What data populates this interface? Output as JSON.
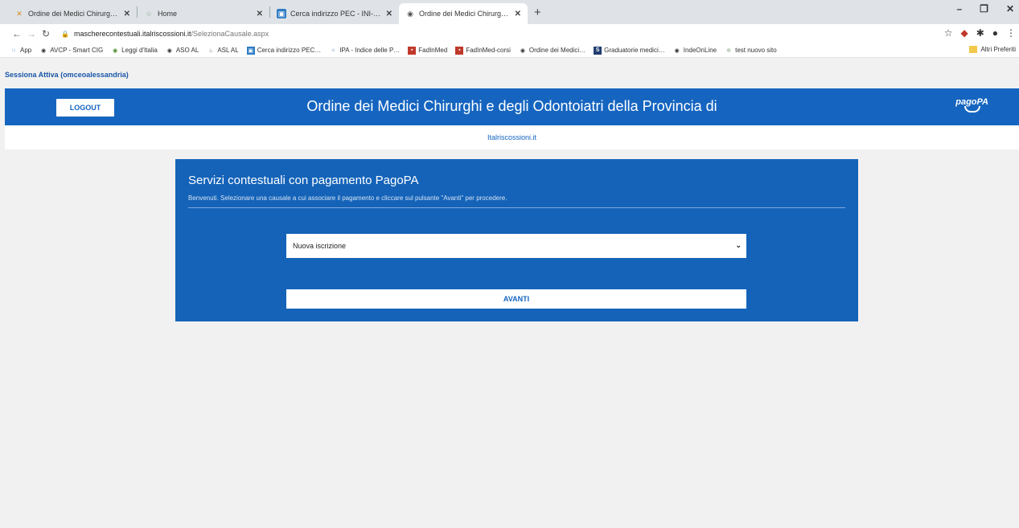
{
  "browser": {
    "tabs": [
      {
        "title": "Ordine dei Medici Chirurghi e d…"
      },
      {
        "title": "Home"
      },
      {
        "title": "Cerca indirizzo PEC - INI-PEC"
      },
      {
        "title": "Ordine dei Medici Chirurghi e d…"
      }
    ],
    "new_tab": "+",
    "url_host": "mascherecontestuali.italriscossioni.it",
    "url_path": "/SelezionaCausale.aspx",
    "bookmarks": [
      {
        "label": "App"
      },
      {
        "label": "AVCP - Smart CIG"
      },
      {
        "label": "Leggi d'Italia"
      },
      {
        "label": "ASO AL"
      },
      {
        "label": "ASL AL"
      },
      {
        "label": "Cerca indirizzo PEC…"
      },
      {
        "label": "IPA - Indice delle P…"
      },
      {
        "label": "FadInMed"
      },
      {
        "label": "FadInMed-corsi"
      },
      {
        "label": "Ordine dei Medici…"
      },
      {
        "label": "Graduatorie medici…"
      },
      {
        "label": "IndeOnLine"
      },
      {
        "label": "test nuovo sito"
      }
    ],
    "other_bookmarks": "Altri Preferiti"
  },
  "page": {
    "session": "Sessiona Attiva (omceoalessandria)",
    "logout": "LOGOUT",
    "org_title": "Ordine dei Medici Chirurghi e degli Odontoiatri della Provincia di",
    "logo_text": "pagoPA",
    "subheader": "Italriscossioni.it",
    "panel_title": "Servizi contestuali con pagamento PagoPA",
    "panel_subtitle": "Benvenuti. Selezionare una causale a cui associare il pagamento e cliccare sul pulsante \"Avanti\" per procedere.",
    "select_value": "Nuova iscrizione",
    "avanti": "AVANTI"
  },
  "colors": {
    "brand_blue": "#1565c0",
    "panel_blue": "#1463b8"
  }
}
